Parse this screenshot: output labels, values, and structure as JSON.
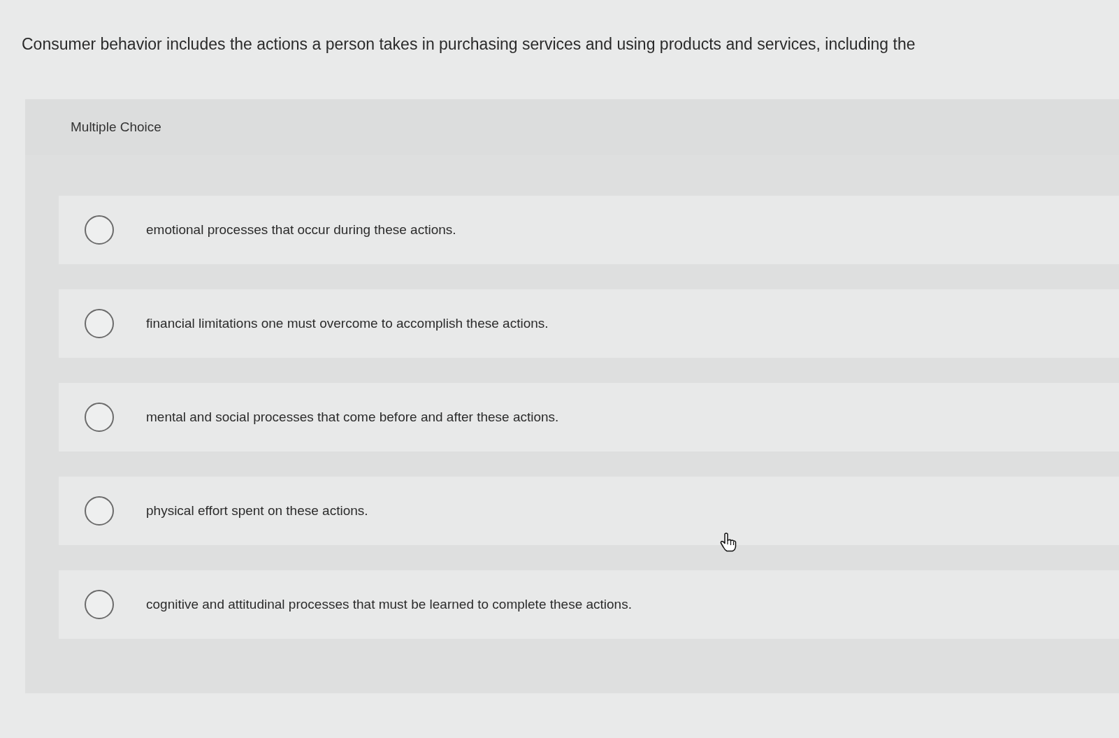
{
  "question": {
    "text": "Consumer behavior includes the actions a person takes in purchasing services and using products and services, including the"
  },
  "panel": {
    "header": "Multiple Choice",
    "choices": [
      {
        "text": "emotional processes that occur during these actions.",
        "selected": false
      },
      {
        "text": "financial limitations one must overcome to accomplish these actions.",
        "selected": false
      },
      {
        "text": "mental and social processes that come before and after these actions.",
        "selected": false
      },
      {
        "text": "physical effort spent on these actions.",
        "selected": false
      },
      {
        "text": "cognitive and attitudinal processes that must be learned to complete these actions.",
        "selected": false
      }
    ]
  }
}
